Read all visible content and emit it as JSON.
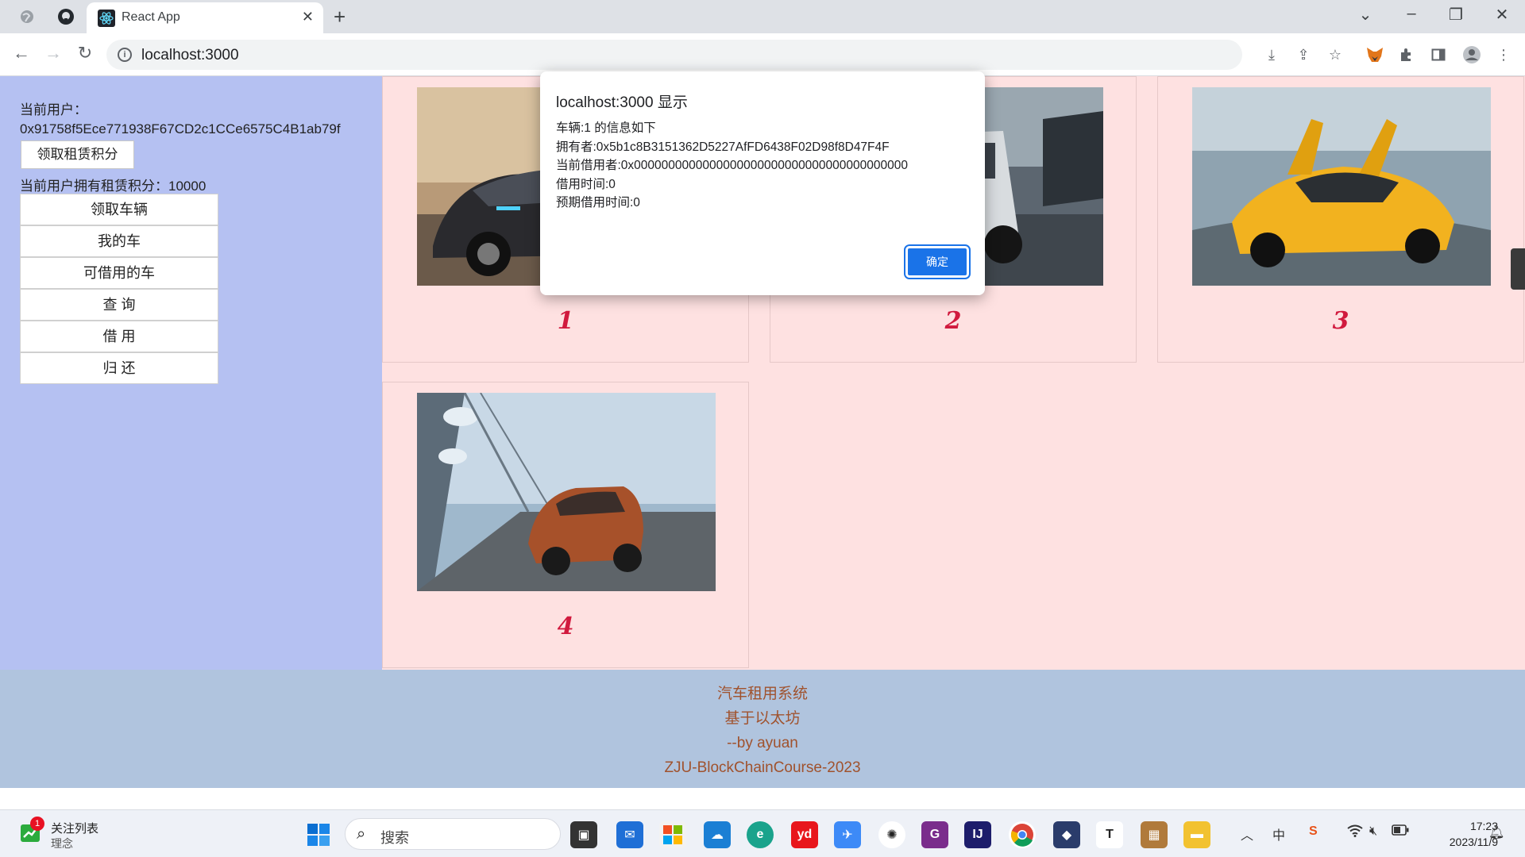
{
  "browser": {
    "tab_title": "React App",
    "url": "localhost:3000"
  },
  "sidebar": {
    "current_user_label": "当前用户：",
    "current_user_address": "0x91758f5Ece771938F67CD2c1CCe6575C4B1ab79f",
    "claim_points_button": "领取租赁积分",
    "points_text": "当前用户拥有租赁积分：10000",
    "menu": [
      {
        "label": "领取车辆"
      },
      {
        "label": "我的车"
      },
      {
        "label": "可借用的车"
      },
      {
        "label": "查 询"
      },
      {
        "label": "借 用"
      },
      {
        "label": "归 还"
      }
    ]
  },
  "cars": [
    {
      "number": "1"
    },
    {
      "number": "2"
    },
    {
      "number": "3"
    },
    {
      "number": "4"
    }
  ],
  "footer": {
    "line1": "汽车租用系统",
    "line2": "基于以太坊",
    "line3": "--by ayuan",
    "line4": "ZJU-BlockChainCourse-2023"
  },
  "dialog": {
    "title": "localhost:3000 显示",
    "lines": [
      "车辆:1 的信息如下",
      "拥有者:0x5b1c8B3151362D5227AfFD6438F02D98f8D47F4F",
      "当前借用者:0x0000000000000000000000000000000000000000",
      "借用时间:0",
      "预期借用时间:0"
    ],
    "ok_button": "确定"
  },
  "taskbar": {
    "watchlist_title": "关注列表",
    "watchlist_sub": "理念",
    "watchlist_badge": "1",
    "search_placeholder": "搜索",
    "time": "17:23",
    "date": "2023/11/9"
  }
}
